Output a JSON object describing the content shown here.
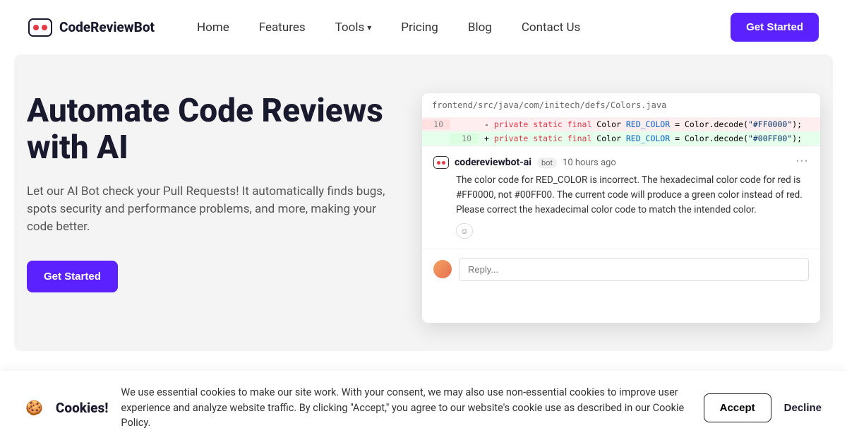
{
  "brand": "CodeReviewBot",
  "nav": {
    "home": "Home",
    "features": "Features",
    "tools": "Tools",
    "pricing": "Pricing",
    "blog": "Blog",
    "contact": "Contact Us"
  },
  "cta": "Get Started",
  "hero": {
    "title": "Automate Code Reviews with AI",
    "desc": "Let our AI Bot check your Pull Requests! It automatically finds bugs, spots security and performance problems, and more, making your code better.",
    "button": "Get Started"
  },
  "review": {
    "file_path": "frontend/src/java/com/initech/defs/Colors.java",
    "line_old": "10",
    "line_new": "10",
    "removed_prefix": "- ",
    "added_prefix": "+ ",
    "kw_private": "private",
    "kw_static": "static",
    "kw_final": "final",
    "type": " Color ",
    "var": "RED_COLOR",
    "decode": " = Color.decode(",
    "str_old": "\"#FF0000\"",
    "str_new": "\"#00FF00\"",
    "end": ");",
    "author": "codereviewbot-ai",
    "badge": "bot",
    "time": "10 hours ago",
    "body": "The color code for RED_COLOR is incorrect. The hexadecimal color code for red is #FF0000, not #00FF00. The current code will produce a green color instead of red. Please correct the hexadecimal color code to match the intended color.",
    "reply_placeholder": "Reply..."
  },
  "cookies": {
    "icon": "🍪",
    "title": "Cookies!",
    "text": "We use essential cookies to make our site work. With your consent, we may also use non-essential cookies to improve user experience and analyze website traffic. By clicking \"Accept,\" you agree to our website's cookie use as described in our Cookie Policy.",
    "accept": "Accept",
    "decline": "Decline"
  }
}
